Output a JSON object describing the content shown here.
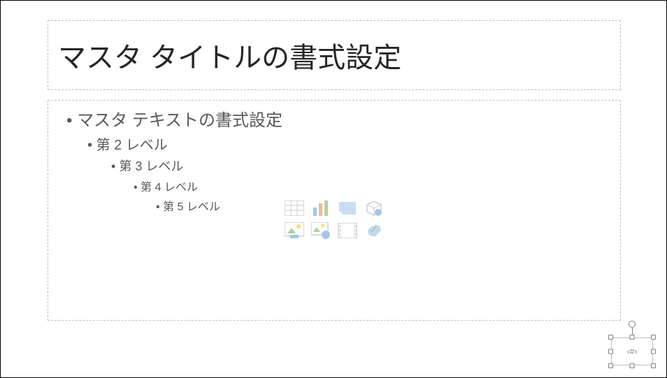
{
  "slide": {
    "title": "マスタ タイトルの書式設定",
    "content": {
      "lvl1": "マスタ テキストの書式設定",
      "lvl2": "第 2 レベル",
      "lvl3": "第 3 レベル",
      "lvl4": "第 4 レベル",
      "lvl5": "第 5 レベル"
    },
    "content_icons": {
      "r1c1": "insert-table-icon",
      "r1c2": "insert-chart-icon",
      "r1c3": "insert-smartart-icon",
      "r1c4": "insert-3d-model-icon",
      "r2c1": "insert-picture-icon",
      "r2c2": "insert-online-picture-icon",
      "r2c3": "insert-video-icon",
      "r2c4": "insert-icon-icon"
    },
    "slide_number": "‹#›"
  },
  "colors": {
    "placeholder_border": "#bfbfbf",
    "text_primary": "#262626",
    "text_secondary": "#595959",
    "icon_blue": "#5b9bd5",
    "icon_gray": "#a6a6a6",
    "icon_green": "#70ad47"
  }
}
